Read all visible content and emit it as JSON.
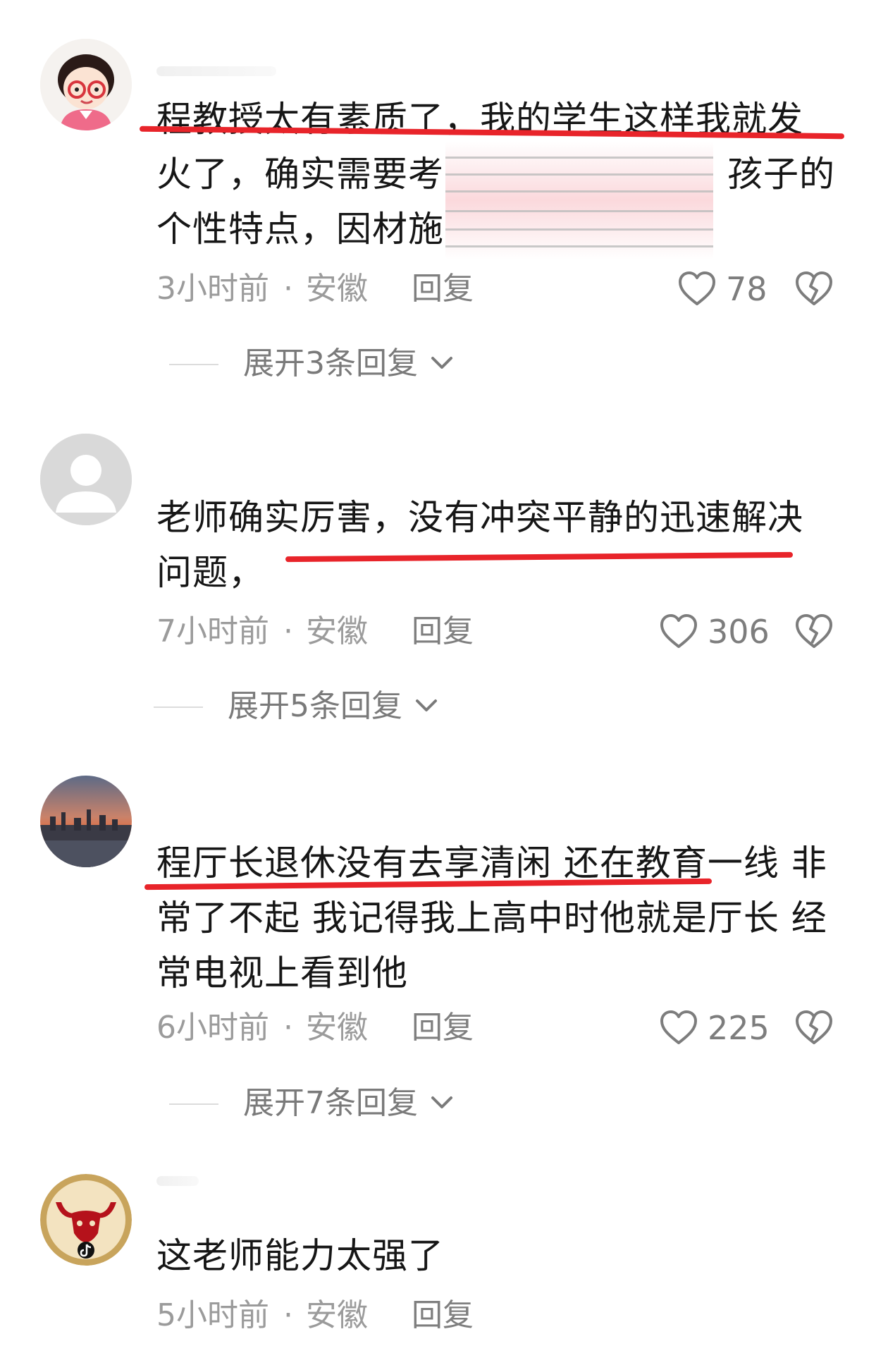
{
  "comments": [
    {
      "lines": [
        "程教授太有素质了，我的学生这样我就发",
        "火了，确实需要考",
        "个性特点，因材施"
      ],
      "line2_tail": "孩子的",
      "time": "3小时前",
      "dot": "·",
      "region": "安徽",
      "reply": "回复",
      "likes": "78",
      "expand": "展开3条回复"
    },
    {
      "lines": [
        "老师确实厉害，没有冲突平静的迅速解决",
        "问题，"
      ],
      "time": "7小时前",
      "dot": "·",
      "region": "安徽",
      "reply": "回复",
      "likes": "306",
      "expand": "展开5条回复"
    },
    {
      "lines": [
        "程厅长退休没有去享清闲 还在教育一线 非",
        "常了不起 我记得我上高中时他就是厅长 经",
        "常电视上看到他"
      ],
      "time": "6小时前",
      "dot": "·",
      "region": "安徽",
      "reply": "回复",
      "likes": "225",
      "expand": "展开7条回复"
    },
    {
      "lines": [
        "这老师能力太强了"
      ],
      "time": "5小时前",
      "dot": "·",
      "region": "安徽",
      "reply": "回复"
    }
  ],
  "colors": {
    "underline": "#e8242a",
    "meta": "#9b9b9b",
    "text": "#161616"
  },
  "icons": [
    "heart-outline-icon",
    "broken-heart-icon",
    "chevron-down-icon",
    "default-user-icon",
    "tiktok-logo-icon"
  ]
}
